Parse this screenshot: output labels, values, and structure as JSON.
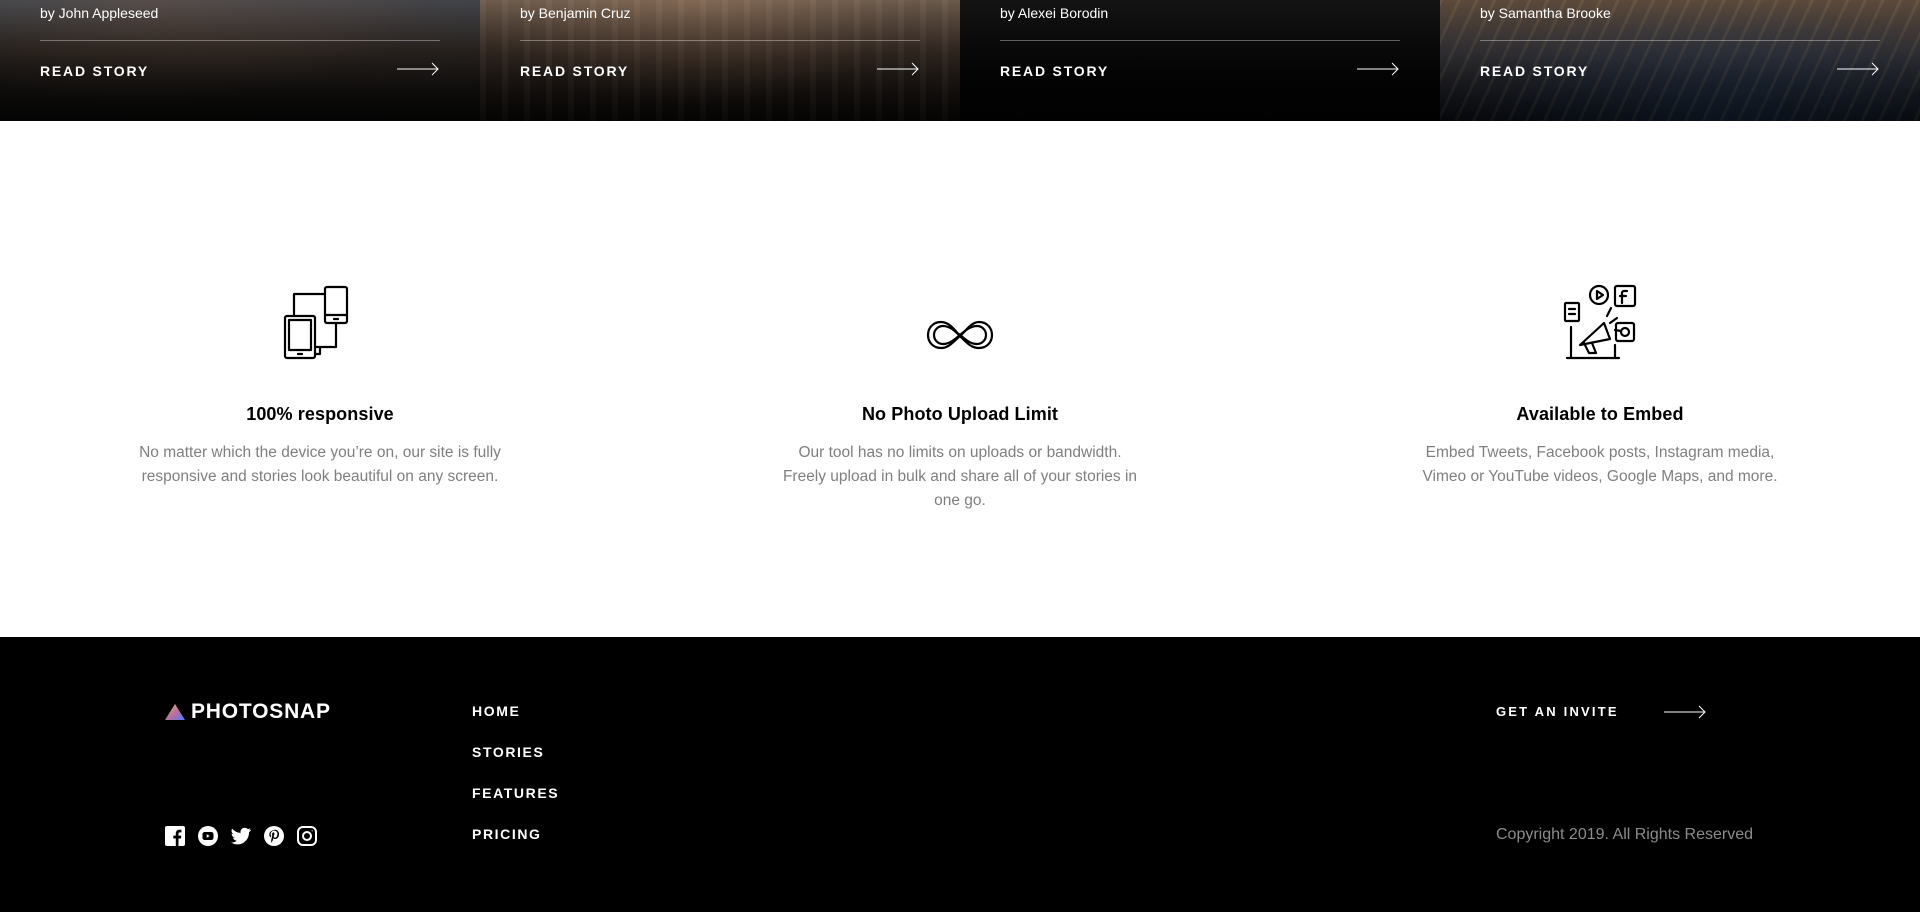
{
  "stories": [
    {
      "author": "by John Appleseed",
      "cta": "READ STORY"
    },
    {
      "author": "by Benjamin Cruz",
      "cta": "READ STORY"
    },
    {
      "author": "by Alexei Borodin",
      "cta": "READ STORY"
    },
    {
      "author": "by Samantha Brooke",
      "cta": "READ STORY"
    }
  ],
  "features": [
    {
      "icon": "responsive-devices-icon",
      "title": "100% responsive",
      "description": "No matter which the device you’re on, our site is fully responsive and stories look beautiful on any screen."
    },
    {
      "icon": "infinity-icon",
      "title": "No Photo Upload Limit",
      "description": "Our tool has no limits on uploads or bandwidth. Freely upload in bulk and share all of your stories in one go."
    },
    {
      "icon": "embed-media-icon",
      "title": "Available to Embed",
      "description": "Embed Tweets, Facebook posts, Instagram media, Vimeo or YouTube videos, Google Maps, and more."
    }
  ],
  "footer": {
    "logo_text": "PHOTOSNAP",
    "nav": [
      "HOME",
      "STORIES",
      "FEATURES",
      "PRICING"
    ],
    "socials": [
      "facebook-icon",
      "youtube-icon",
      "twitter-icon",
      "pinterest-icon",
      "instagram-icon"
    ],
    "invite_label": "GET AN INVITE",
    "copyright": "Copyright 2019. All Rights Reserved"
  },
  "colors": {
    "footer_bg": "#000000",
    "body_text_muted": "#7F7F7F",
    "copyright_text": "#8C8C8C",
    "logo_gradient": [
      "#FFC593",
      "#BC7198",
      "#5A77FF"
    ]
  }
}
